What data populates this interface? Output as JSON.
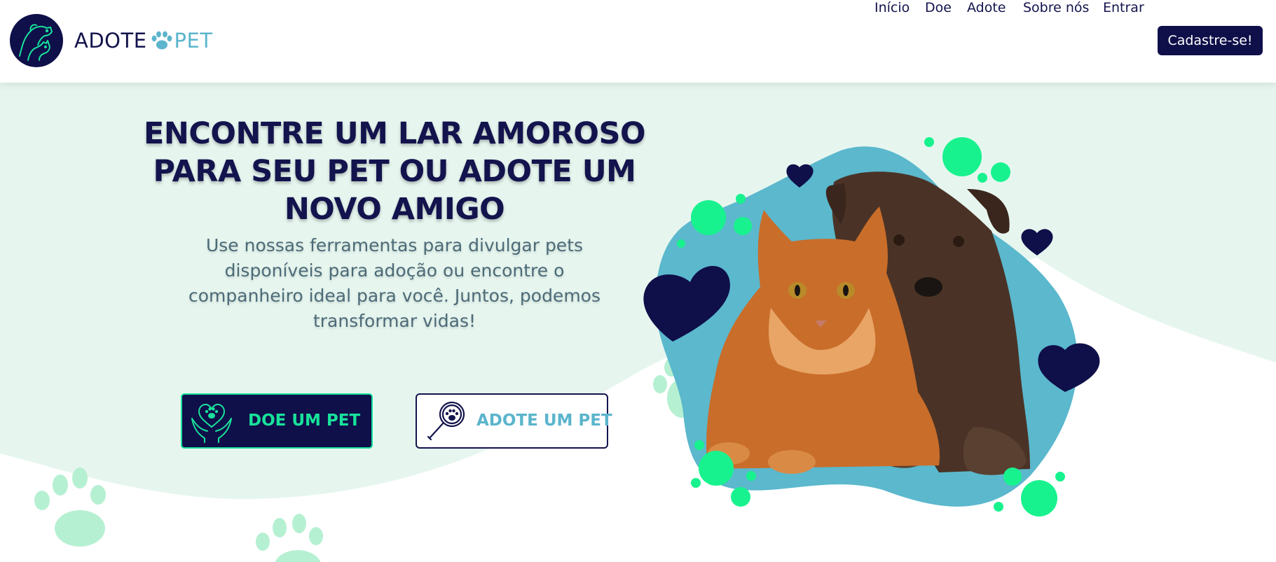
{
  "brand": {
    "name_part1": "ADOTE",
    "name_part2": "PET",
    "colors": {
      "navy": "#0f0f4a",
      "teal": "#5bb5cc",
      "green": "#18e29a",
      "mint_bg": "#e6f6ef"
    }
  },
  "nav": {
    "items": [
      {
        "label": "Início"
      },
      {
        "label": "Doe"
      },
      {
        "label": "Adote"
      },
      {
        "label": "Sobre nós"
      },
      {
        "label": "Entrar"
      }
    ],
    "cta_label": "Cadastre-se!"
  },
  "hero": {
    "title": "ENCONTRE UM LAR AMOROSO PARA SEU PET OU ADOTE UM NOVO AMIGO",
    "subtitle": "Use nossas ferramentas para divulgar pets disponíveis para adoção ou encontre o companheiro ideal para você. Juntos, podemos transformar vidas!",
    "donate_button": {
      "label": "DOE UM PET",
      "icon": "heart-hands-paw-icon"
    },
    "adopt_button": {
      "label": "ADOTE UM PET",
      "icon": "magnifier-paw-icon"
    },
    "image": {
      "subject": "orange-cat-and-brown-dog"
    }
  }
}
